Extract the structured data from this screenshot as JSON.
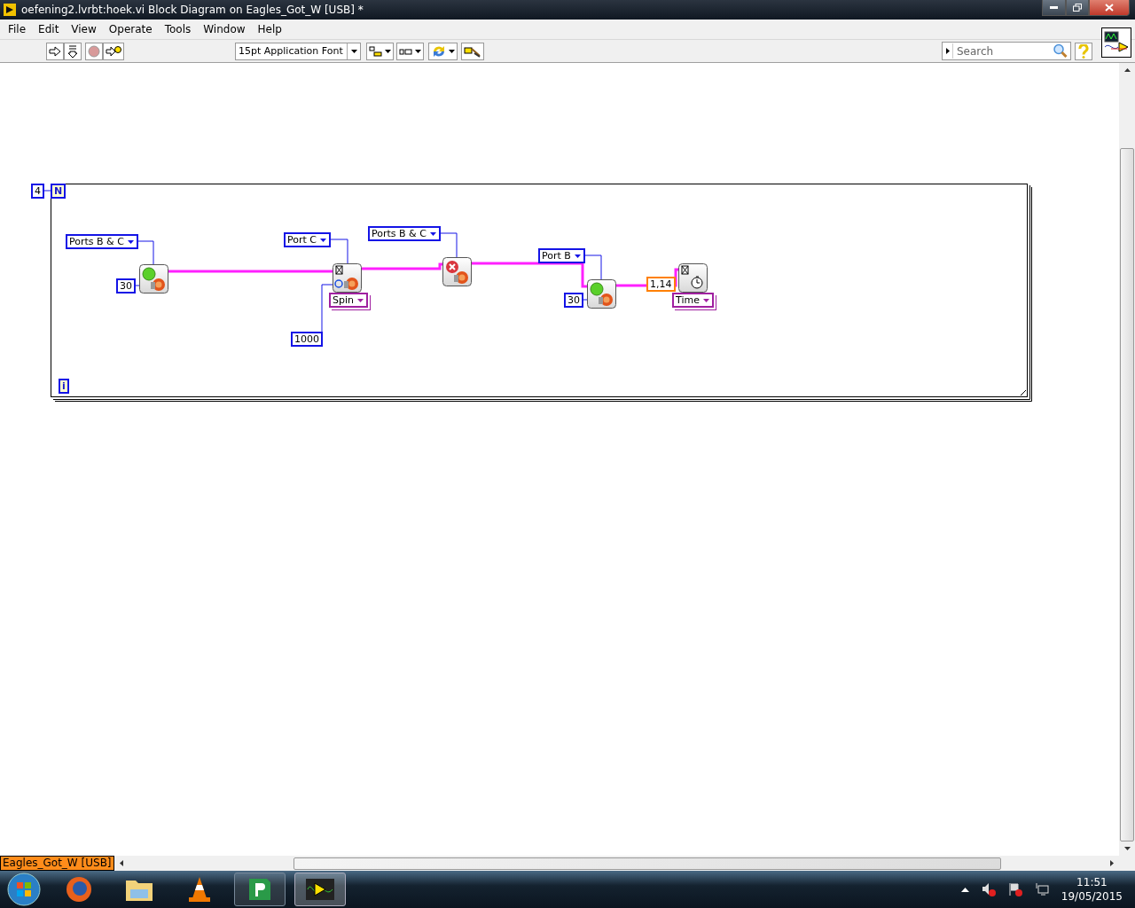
{
  "window": {
    "title": "oefening2.lvrbt:hoek.vi Block Diagram on Eagles_Got_W [USB] *"
  },
  "menu": [
    "File",
    "Edit",
    "View",
    "Operate",
    "Tools",
    "Window",
    "Help"
  ],
  "toolbar": {
    "font": "15pt Application Font",
    "search": {
      "placeholder": "Search"
    }
  },
  "diagram": {
    "loop": {
      "count": "4",
      "count_terminal": "N",
      "iteration_terminal": "i"
    },
    "nodes": [
      {
        "kind": "motor-on",
        "port": "Ports B & C",
        "power": "30"
      },
      {
        "kind": "wait-motor",
        "port": "Port C",
        "mode": "Spin",
        "duration": "1000"
      },
      {
        "kind": "motor-off",
        "port": "Ports B & C"
      },
      {
        "kind": "motor-on",
        "port": "Port B",
        "power": "30"
      },
      {
        "kind": "wait",
        "mode": "Time",
        "duration": "1,14"
      }
    ]
  },
  "target": "Eagles_Got_W [USB]",
  "clock": {
    "time": "11:51",
    "date": "19/05/2015"
  }
}
